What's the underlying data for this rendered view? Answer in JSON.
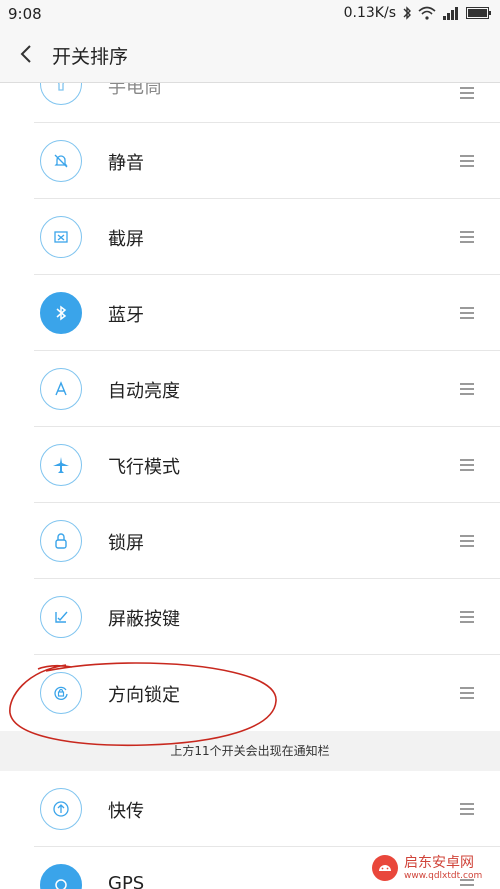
{
  "status": {
    "time": "9:08",
    "speed": "0.13K/s"
  },
  "header": {
    "title": "开关排序"
  },
  "toggles_top": [
    {
      "label": "手电筒",
      "icon": "flashlight-icon"
    },
    {
      "label": "静音",
      "icon": "mute-bell-icon"
    },
    {
      "label": "截屏",
      "icon": "screenshot-icon"
    },
    {
      "label": "蓝牙",
      "icon": "bluetooth-icon",
      "active": true
    },
    {
      "label": "自动亮度",
      "icon": "auto-brightness-icon"
    },
    {
      "label": "飞行模式",
      "icon": "airplane-icon"
    },
    {
      "label": "锁屏",
      "icon": "lock-icon"
    },
    {
      "label": "屏蔽按键",
      "icon": "block-keys-icon"
    },
    {
      "label": "方向锁定",
      "icon": "rotation-lock-icon"
    }
  ],
  "note": "上方11个开关会出现在通知栏",
  "toggles_bottom": [
    {
      "label": "快传",
      "icon": "quick-transfer-icon"
    },
    {
      "label": "GPS",
      "icon": "gps-icon"
    }
  ],
  "watermark": {
    "text": "启东安卓网",
    "sub": "www.qdlxtdt.com"
  },
  "colors": {
    "accent": "#3aa4ea",
    "annotation": "#d0443a"
  }
}
